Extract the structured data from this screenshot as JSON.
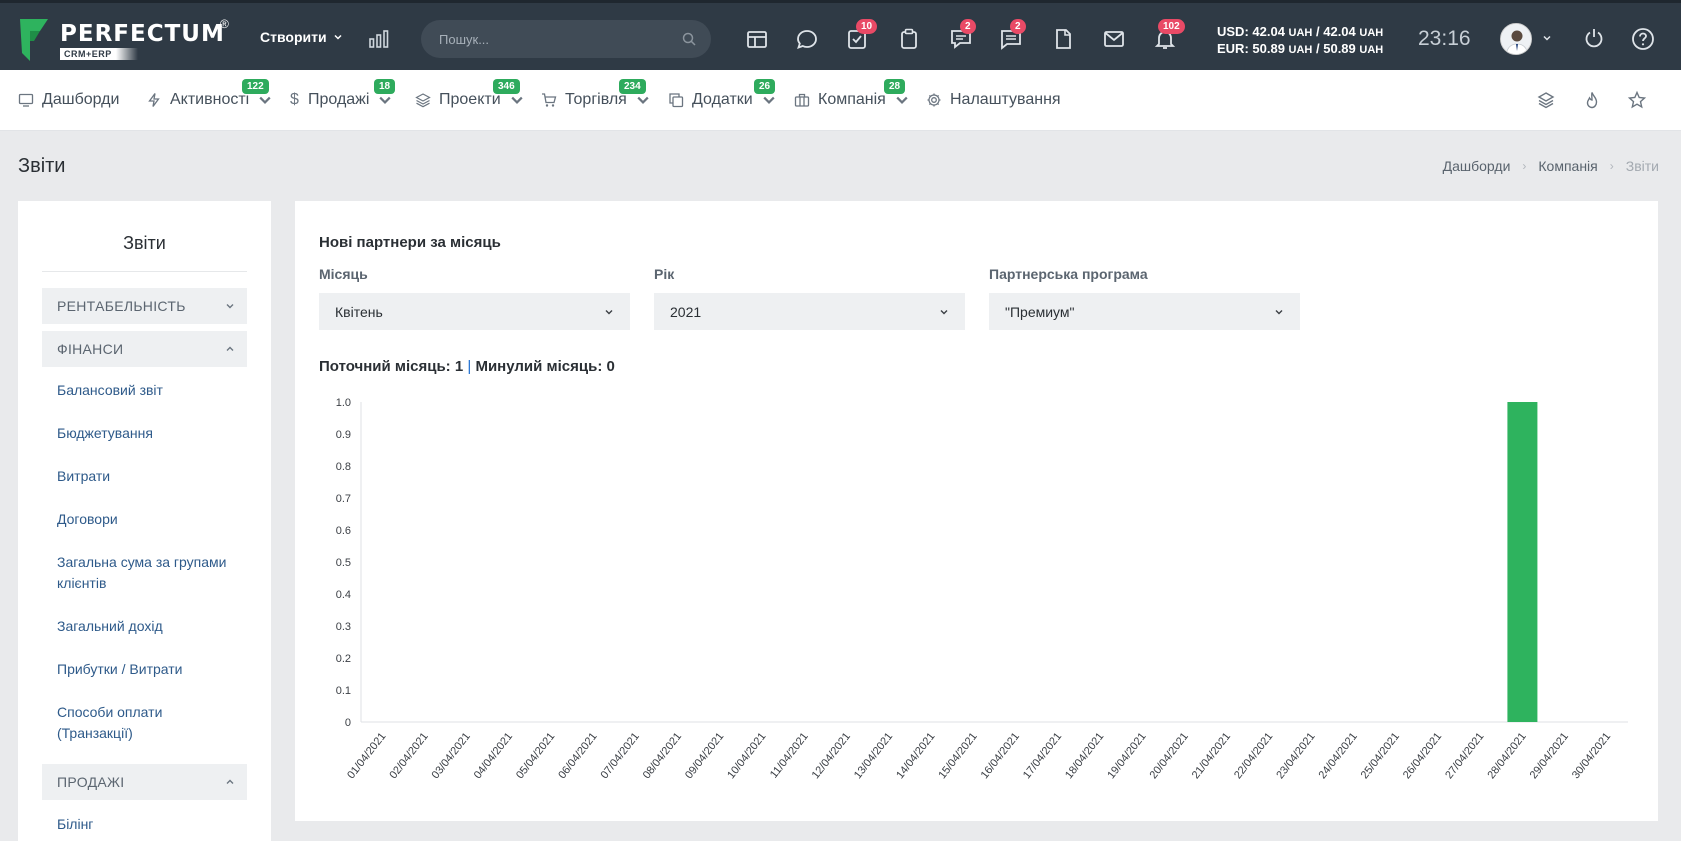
{
  "topbar": {
    "logo_text": "PERFECTUM",
    "logo_reg": "®",
    "logo_sub": "CRM+ERP",
    "create_label": "Створити",
    "search_placeholder": "Пошук...",
    "badges": {
      "tasks": "10",
      "chat": "2",
      "comments": "2",
      "notifications": "102"
    },
    "currency_usd": "USD: 42.04",
    "currency_usd_rest": "/ 42.04",
    "currency_eur": "EUR: 50.89",
    "currency_eur_rest": "/ 50.89",
    "currency_unit": "UAH",
    "time": "23:16"
  },
  "menu": {
    "items": [
      {
        "label": "Дашборди",
        "badge": ""
      },
      {
        "label": "Активності",
        "badge": "122"
      },
      {
        "label": "Продажі",
        "badge": "18"
      },
      {
        "label": "Проекти",
        "badge": "346"
      },
      {
        "label": "Торгівля",
        "badge": "234"
      },
      {
        "label": "Додатки",
        "badge": "26"
      },
      {
        "label": "Компанія",
        "badge": "28"
      },
      {
        "label": "Налаштування",
        "badge": ""
      }
    ]
  },
  "page": {
    "title": "Звіти",
    "breadcrumb": [
      "Дашборди",
      "Компанія",
      "Звіти"
    ]
  },
  "sidebar": {
    "title": "Звіти",
    "sections": [
      {
        "label": "РЕНТАБЕЛЬНІСТЬ",
        "expanded": false
      },
      {
        "label": "ФІНАНСИ",
        "expanded": true
      },
      {
        "label": "ПРОДАЖІ",
        "expanded": true
      }
    ],
    "finance_links": [
      "Балансовий звіт",
      "Бюджетування",
      "Витрати",
      "Договори",
      "Загальна сума за групами клієнтів",
      "Загальний дохід",
      "Прибутки / Витрати",
      "Способи оплати (Транзакції)"
    ],
    "sales_links": [
      "Білінг"
    ]
  },
  "report": {
    "title": "Нові партнери за місяць",
    "month_label": "Місяць",
    "month_value": "Квітень",
    "year_label": "Рік",
    "year_value": "2021",
    "program_label": "Партнерська програма",
    "program_value": "\"Премиум\"",
    "current_label": "Поточний місяць: 1",
    "separator": "|",
    "previous_label": "Минулий місяць: 0"
  },
  "colors": {
    "topbar_bg": "#2f3a45",
    "badge_red": "#e94a66",
    "badge_green": "#2eab5d",
    "bar_green": "#2eb35e",
    "link_blue": "#2e5a8a"
  },
  "chart_data": {
    "type": "bar",
    "categories": [
      "01/04/2021",
      "02/04/2021",
      "03/04/2021",
      "04/04/2021",
      "05/04/2021",
      "06/04/2021",
      "07/04/2021",
      "08/04/2021",
      "09/04/2021",
      "10/04/2021",
      "11/04/2021",
      "12/04/2021",
      "13/04/2021",
      "14/04/2021",
      "15/04/2021",
      "16/04/2021",
      "17/04/2021",
      "18/04/2021",
      "19/04/2021",
      "20/04/2021",
      "21/04/2021",
      "22/04/2021",
      "23/04/2021",
      "24/04/2021",
      "25/04/2021",
      "26/04/2021",
      "27/04/2021",
      "28/04/2021",
      "29/04/2021",
      "30/04/2021"
    ],
    "values": [
      0,
      0,
      0,
      0,
      0,
      0,
      0,
      0,
      0,
      0,
      0,
      0,
      0,
      0,
      0,
      0,
      0,
      0,
      0,
      0,
      0,
      0,
      0,
      0,
      0,
      0,
      0,
      1,
      0,
      0
    ],
    "ylim": [
      0,
      1
    ],
    "yticks": [
      "0",
      "0.1",
      "0.2",
      "0.3",
      "0.4",
      "0.5",
      "0.6",
      "0.7",
      "0.8",
      "0.9",
      "1.0"
    ],
    "title": "",
    "xlabel": "",
    "ylabel": "",
    "grid": false
  }
}
